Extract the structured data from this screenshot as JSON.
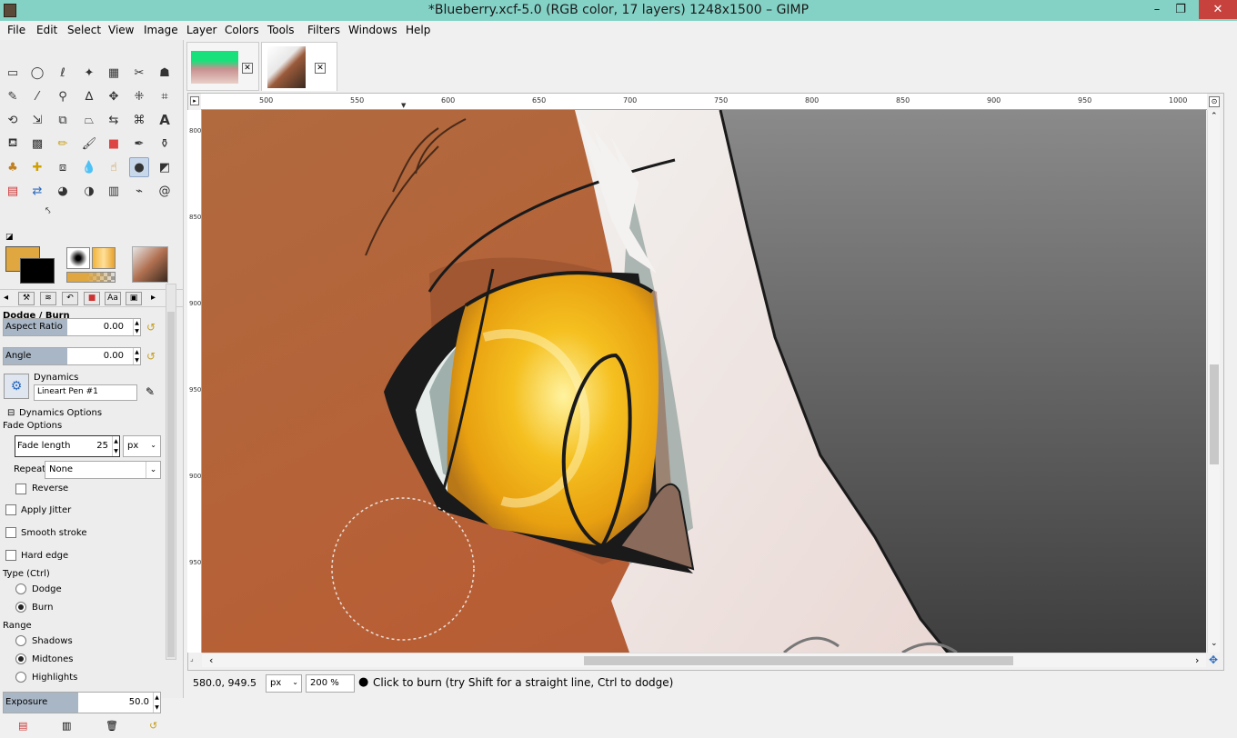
{
  "window": {
    "title": "*Blueberry.xcf-5.0 (RGB color, 17 layers) 1248x1500 – GIMP",
    "min": "–",
    "max": "❐",
    "close": "✕"
  },
  "menu": [
    "File",
    "Edit",
    "Select",
    "View",
    "Image",
    "Layer",
    "Colors",
    "Tools",
    "Filters",
    "Windows",
    "Help"
  ],
  "tool_options": {
    "title": "Dodge / Burn",
    "aspect_ratio": {
      "label": "Aspect Ratio",
      "value": "0.00"
    },
    "angle": {
      "label": "Angle",
      "value": "0.00"
    },
    "dynamics_label": "Dynamics",
    "dynamics_value": "Lineart Pen #1",
    "dynamics_options": "Dynamics Options",
    "fade_options": "Fade Options",
    "fade_length": {
      "label": "Fade length",
      "value": "25",
      "unit": "px"
    },
    "repeat_label": "Repeat:",
    "repeat_value": "None",
    "reverse": "Reverse",
    "apply_jitter": "Apply Jitter",
    "smooth_stroke": "Smooth stroke",
    "hard_edge": "Hard edge",
    "type_label": "Type  (Ctrl)",
    "type_dodge": "Dodge",
    "type_burn": "Burn",
    "range_label": "Range",
    "range_shadows": "Shadows",
    "range_midtones": "Midtones",
    "range_highlights": "Highlights",
    "exposure": {
      "label": "Exposure",
      "value": "50.0"
    }
  },
  "ruler_h": [
    "500",
    "550",
    "600",
    "650",
    "700",
    "750",
    "800",
    "850",
    "900",
    "950",
    "1000"
  ],
  "ruler_v": [
    "800",
    "850",
    "900",
    "950"
  ],
  "status": {
    "coords": "580.0, 949.5",
    "unit": "px",
    "zoom": "200 %",
    "message": "Click to burn (try Shift for a straight line, Ctrl to dodge)"
  },
  "colors": {
    "foreground": "#e0a740",
    "background": "#000000",
    "titlebar": "#84d2c6"
  }
}
